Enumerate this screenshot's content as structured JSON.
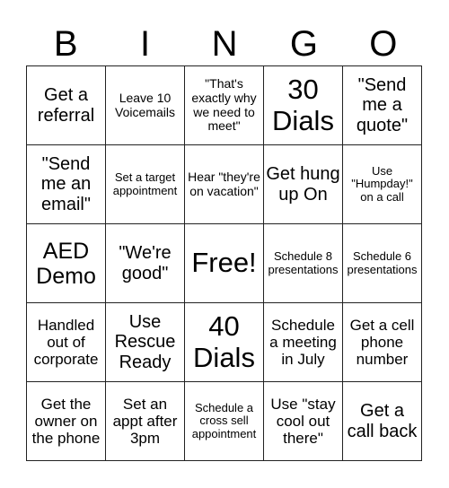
{
  "header": {
    "letters": [
      "B",
      "I",
      "N",
      "G",
      "O"
    ]
  },
  "card": {
    "rows": [
      [
        {
          "text": "Get a referral",
          "size": "lg"
        },
        {
          "text": "Leave 10 Voicemails",
          "size": "sm"
        },
        {
          "text": "\"That's exactly why we need to meet\"",
          "size": "sm"
        },
        {
          "text": "30 Dials",
          "size": "xxl"
        },
        {
          "text": "\"Send me a quote\"",
          "size": "lg"
        }
      ],
      [
        {
          "text": "\"Send me an email\"",
          "size": "lg"
        },
        {
          "text": "Set a target appointment",
          "size": "xs"
        },
        {
          "text": "Hear \"they're on vacation\"",
          "size": "sm"
        },
        {
          "text": "Get hung up On",
          "size": "lg"
        },
        {
          "text": "Use \"Humpday!\" on a call",
          "size": "xs"
        }
      ],
      [
        {
          "text": "AED Demo",
          "size": "xl"
        },
        {
          "text": "\"We're good\"",
          "size": "lg"
        },
        {
          "text": "Free!",
          "size": "xxl"
        },
        {
          "text": "Schedule 8 presentations",
          "size": "xs"
        },
        {
          "text": "Schedule 6 presentations",
          "size": "xs"
        }
      ],
      [
        {
          "text": "Handled out of corporate",
          "size": "md"
        },
        {
          "text": "Use Rescue Ready",
          "size": "lg"
        },
        {
          "text": "40 Dials",
          "size": "xxl"
        },
        {
          "text": "Schedule a meeting in July",
          "size": "md"
        },
        {
          "text": "Get a cell phone number",
          "size": "md"
        }
      ],
      [
        {
          "text": "Get the owner on the phone",
          "size": "md"
        },
        {
          "text": "Set an appt after 3pm",
          "size": "md"
        },
        {
          "text": "Schedule a cross sell appointment",
          "size": "xs"
        },
        {
          "text": "Use \"stay cool out there\"",
          "size": "md"
        },
        {
          "text": "Get a call back",
          "size": "lg"
        }
      ]
    ]
  }
}
